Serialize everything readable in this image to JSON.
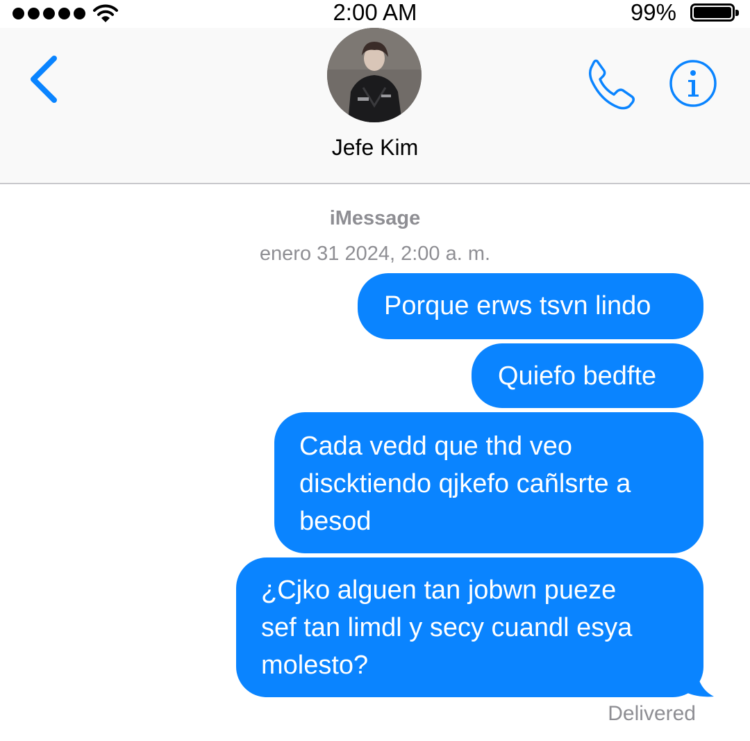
{
  "status_bar": {
    "time": "2:00 AM",
    "battery_percent": "99%",
    "battery_level": 0.99,
    "signal_bars": 5,
    "icons": [
      "signal-dots-icon",
      "wifi-icon",
      "battery-icon"
    ]
  },
  "header": {
    "contact_name": "Jefe Kim",
    "icons": [
      "chevron-left-icon",
      "phone-icon",
      "info-icon"
    ],
    "accent_color": "#0a84ff"
  },
  "conversation": {
    "service": "iMessage",
    "timestamp": "enero 31 2024, 2:00 a. m.",
    "bubble_color": "#0a84ff",
    "messages": [
      {
        "text": "Porque erws tsvn lindo",
        "sender": "me"
      },
      {
        "text": "Quiefo bedfte",
        "sender": "me"
      },
      {
        "text": "Cada vedd que thd veo\ndiscktiendo qjkefo cañlsrte a\nbesod",
        "sender": "me"
      },
      {
        "text": "¿Cjko alguen tan jobwn pueze\nsef tan limdl y secy cuandl esya\nmolesto?",
        "sender": "me"
      }
    ],
    "status": "Delivered"
  }
}
